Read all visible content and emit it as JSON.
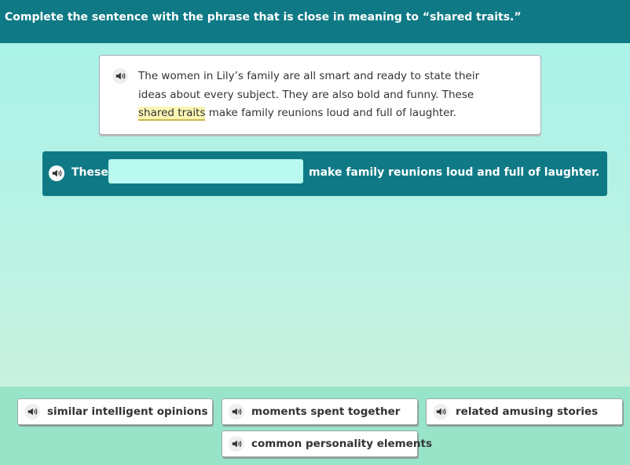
{
  "header": {
    "instruction": "Complete the sentence with the phrase that is close in meaning to “shared traits.”"
  },
  "passage": {
    "text_before": "The women in Lily’s family are all smart and ready to state their ideas about every subject. They are also bold and funny. These ",
    "highlight": "shared traits",
    "text_after": " make family reunions loud and full of laughter."
  },
  "sentence": {
    "before": "These",
    "after": "make family reunions loud and full of laughter."
  },
  "choices": [
    {
      "label": "similar intelligent opinions"
    },
    {
      "label": "moments spent together"
    },
    {
      "label": "related amusing stories"
    },
    {
      "label": "common personality elements"
    }
  ],
  "colors": {
    "header": "#0f7a86",
    "highlight": "#fbf6b4",
    "blank": "#b9f9ef",
    "answer_area": "#98e4c8"
  },
  "icons": {
    "audio": "speaker-icon"
  }
}
